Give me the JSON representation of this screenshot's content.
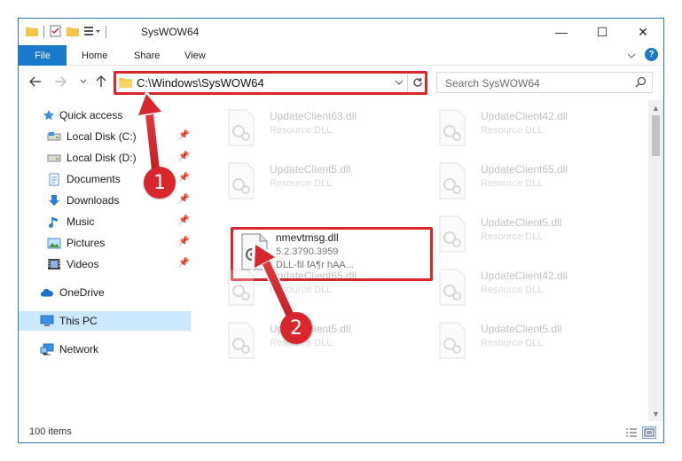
{
  "window": {
    "title": "SysWOW64",
    "controls": {
      "minimize": "—",
      "maximize": "☐",
      "close": "✕"
    }
  },
  "ribbon": {
    "tabs": [
      "File",
      "Home",
      "Share",
      "View"
    ],
    "help": "?"
  },
  "address_bar": {
    "path": "C:\\Windows\\SysWOW64"
  },
  "search": {
    "placeholder": "Search SysWOW64"
  },
  "sidebar": {
    "items": [
      {
        "label": "Quick access",
        "icon": "star-icon"
      },
      {
        "label": "Local Disk (C:)",
        "icon": "drive-icon",
        "pinned": true
      },
      {
        "label": "Local Disk (D:)",
        "icon": "drive-icon",
        "pinned": true
      },
      {
        "label": "Documents",
        "icon": "documents-icon",
        "pinned": true
      },
      {
        "label": "Downloads",
        "icon": "download-icon",
        "pinned": true
      },
      {
        "label": "Music",
        "icon": "music-icon",
        "pinned": true
      },
      {
        "label": "Pictures",
        "icon": "pictures-icon",
        "pinned": true
      },
      {
        "label": "Videos",
        "icon": "videos-icon",
        "pinned": true
      },
      {
        "label": "OneDrive",
        "icon": "cloud-icon"
      },
      {
        "label": "This PC",
        "icon": "pc-icon",
        "selected": true
      },
      {
        "label": "Network",
        "icon": "network-icon"
      }
    ]
  },
  "files": [
    {
      "name": "UpdateClient63.dll",
      "desc": "Resource DLL"
    },
    {
      "name": "UpdateClient42.dll",
      "desc": "Resource DLL"
    },
    {
      "name": "UpdateClient5.dll",
      "desc": "Resource DLL"
    },
    {
      "name": "UpdateClient65.dll",
      "desc": "Resource DLL"
    },
    {
      "name": "nmevtmsg.dll",
      "version": "5.2.3790.3959",
      "desc": "DLL-fil fA¶r hAA..."
    },
    {
      "name": "UpdateClient5.dll",
      "desc": "Resource DLL"
    },
    {
      "name": "UpdateClient65.dll",
      "desc": "Resource DLL"
    },
    {
      "name": "UpdateClient42.dll",
      "desc": "Resource DLL"
    },
    {
      "name": "UpdateClient5.dll",
      "desc": "Resource DLL"
    },
    {
      "name": "UpdateClient5.dll",
      "desc": "Resource DLL"
    }
  ],
  "status": {
    "item_count": "100 items"
  },
  "annotations": {
    "step1": "1",
    "step2": "2"
  },
  "colors": {
    "accent": "#1979ca",
    "highlight": "#d9262c",
    "selected": "#cce8ff"
  }
}
